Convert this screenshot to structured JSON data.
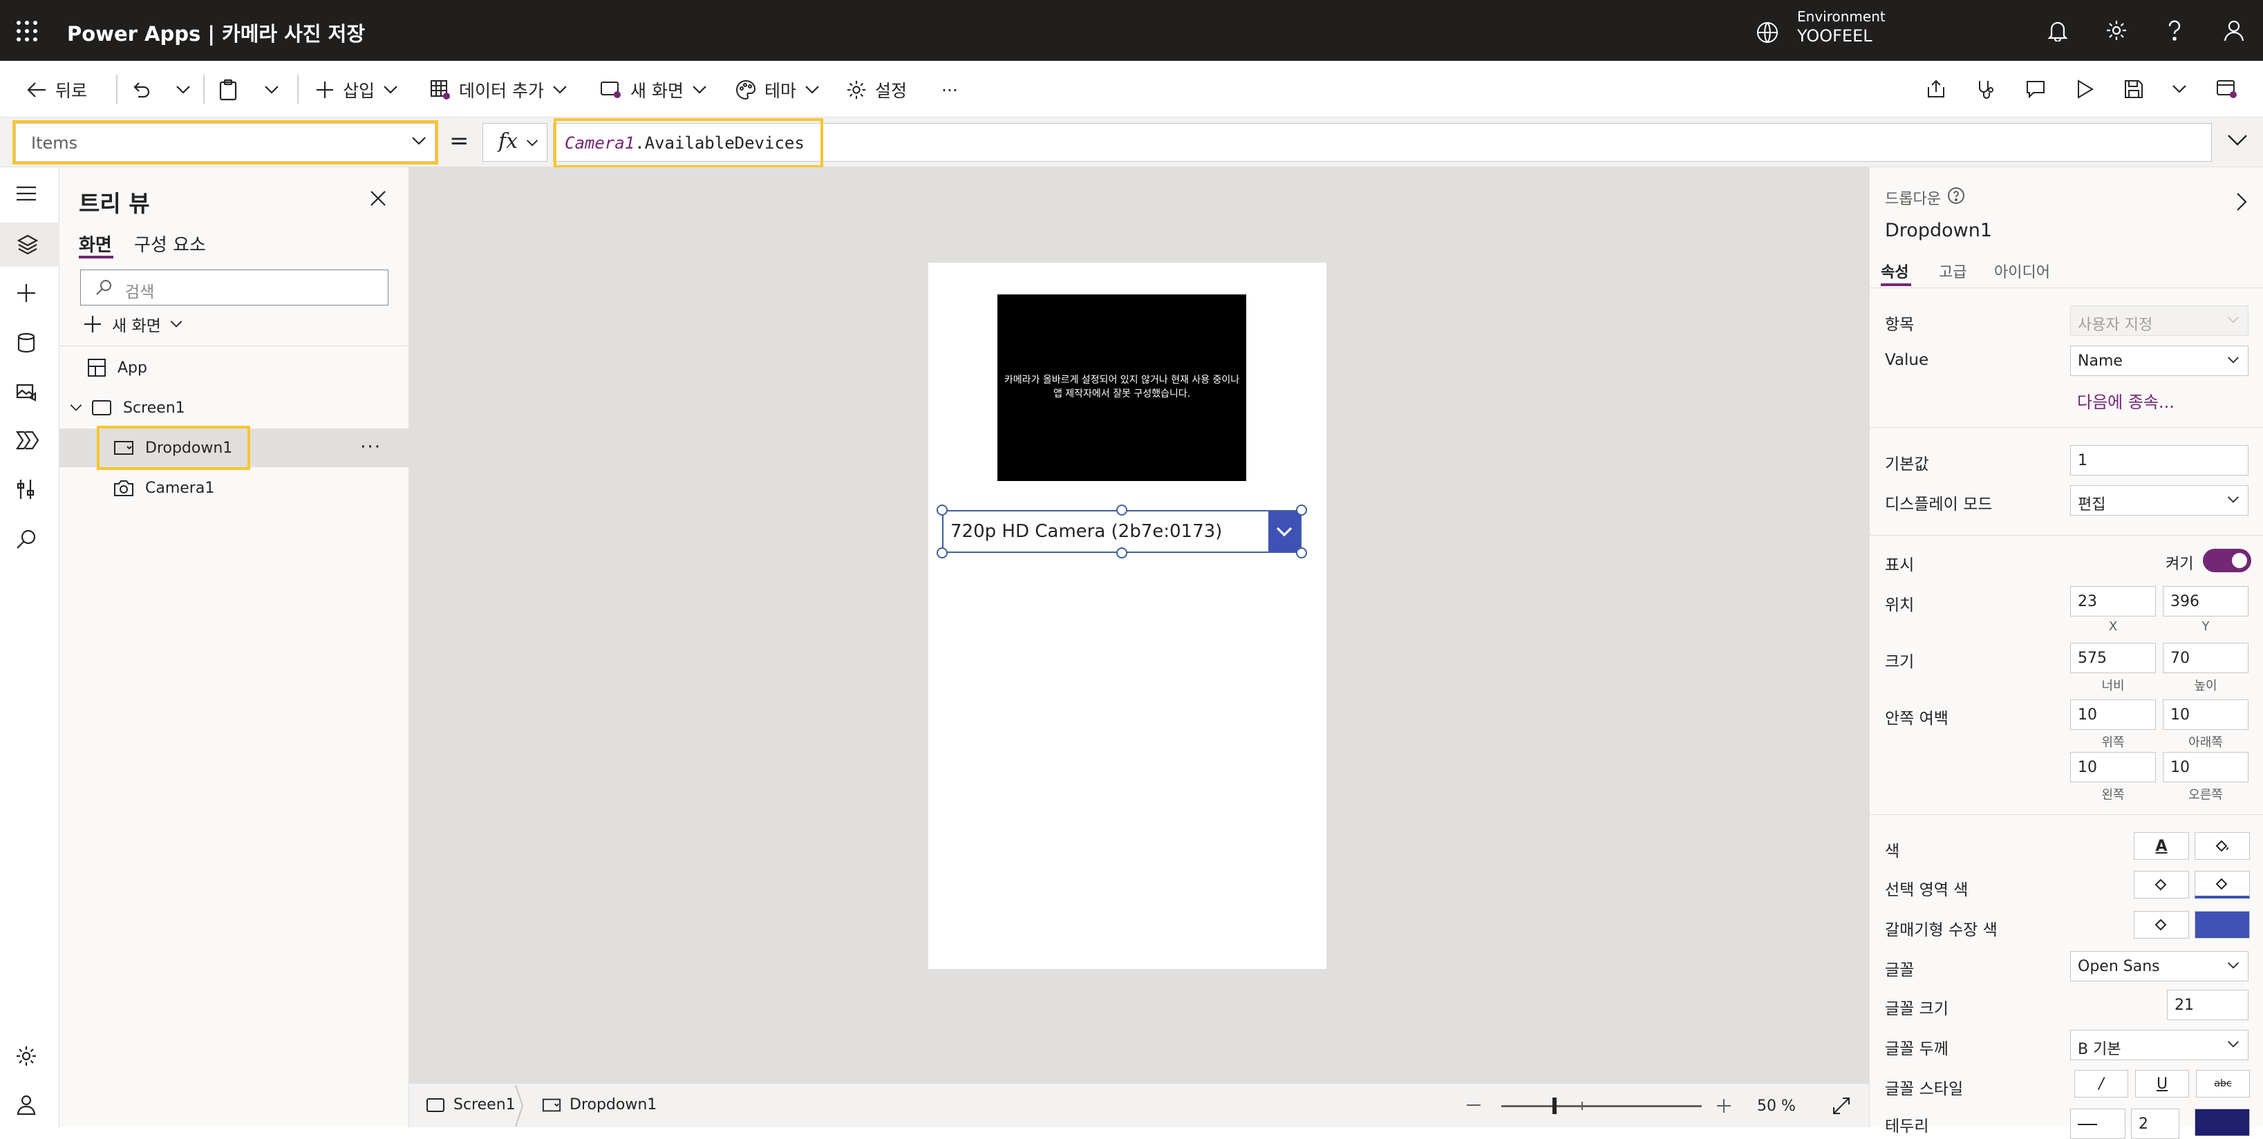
{
  "header": {
    "app_name": "Power Apps  |  카메라 사진 저장",
    "environment_label": "Environment",
    "environment_name": "YOOFEEL"
  },
  "toolbar": {
    "back": "뒤로",
    "insert": "삽입",
    "add_data": "데이터 추가",
    "new_screen": "새 화면",
    "theme": "테마",
    "settings": "설정",
    "more": "···"
  },
  "formula_bar": {
    "property": "Items",
    "equals": "=",
    "fx": "fx",
    "formula_object": "Camera1",
    "formula_member": ".AvailableDevices"
  },
  "tree_view": {
    "title": "트리 뷰",
    "tabs": [
      "화면",
      "구성 요소"
    ],
    "search_placeholder": "검색",
    "new_screen": "새 화면",
    "nodes": {
      "app": "App",
      "screen": "Screen1",
      "dropdown": "Dropdown1",
      "camera": "Camera1"
    },
    "node_more": "···"
  },
  "canvas": {
    "camera_message": "카메라가 올바르게 설정되어 있지 않거나 현재 사용 중이나 앱 제작자에서 잘못 구성했습니다.",
    "dropdown_value": "720p HD Camera (2b7e:0173)"
  },
  "status_bar": {
    "screen": "Screen1",
    "control": "Dropdown1",
    "zoom_value": "50",
    "zoom_unit": "%",
    "zoom_fraction": 0.5
  },
  "properties": {
    "control_type": "드롭다운",
    "control_name": "Dropdown1",
    "tabs": [
      "속성",
      "고급",
      "아이디어"
    ],
    "items_label": "항목",
    "items_value": "사용자 지정",
    "value_label": "Value",
    "value_value": "Name",
    "depends_link": "다음에 종속...",
    "default_label": "기본값",
    "default_value": "1",
    "display_mode_label": "디스플레이 모드",
    "display_mode_value": "편집",
    "visible_label": "표시",
    "visible_state": "켜기",
    "position_label": "위치",
    "x": "23",
    "y": "396",
    "x_label": "X",
    "y_label": "Y",
    "size_label": "크기",
    "width": "575",
    "height": "70",
    "width_label": "너비",
    "height_label": "높이",
    "padding_label": "안쪽 여백",
    "pad_top": "10",
    "pad_bottom": "10",
    "pad_left": "10",
    "pad_right": "10",
    "pad_top_label": "위쪽",
    "pad_bottom_label": "아래쪽",
    "pad_left_label": "왼쪽",
    "pad_right_label": "오른쪽",
    "color_label": "색",
    "selection_color_label": "선택 영역 색",
    "chevron_fill_label": "갈매기형 수장 색",
    "font_label": "글꼴",
    "font_value": "Open Sans",
    "font_size_label": "글꼴 크기",
    "font_size_value": "21",
    "font_weight_label": "글꼴 두께",
    "font_weight_value": "B  기본",
    "font_style_label": "글꼴 스타일",
    "border_label": "테두리",
    "border_value": "2",
    "text_color_glyph": "A",
    "italic_glyph": "/",
    "underline_glyph": "U",
    "strike_glyph": "abc"
  },
  "colors": {
    "topbar": "#201f1e",
    "accent": "#742774",
    "dropdown_button": "#3f51b5",
    "highlight": "#f7c62f"
  }
}
